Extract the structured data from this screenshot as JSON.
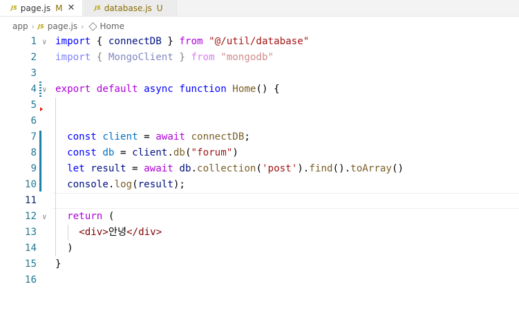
{
  "tabs": [
    {
      "badge": "JS",
      "name": "page.js",
      "status": "M",
      "close": "✕"
    },
    {
      "badge": "JS",
      "name": "database.js",
      "status": "U"
    }
  ],
  "breadcrumb": {
    "folder": "app",
    "file_badge": "JS",
    "file": "page.js",
    "symbol": "Home"
  },
  "colors": {
    "keyword": "#0000ff",
    "control": "#af00db",
    "variable": "#001080",
    "function": "#795e26",
    "string": "#a31515",
    "line_number": "#237893"
  },
  "code_lines": [
    {
      "number": "1",
      "tokens": [
        [
          "kw",
          "import"
        ],
        [
          "punc",
          " { "
        ],
        [
          "var",
          "connectDB"
        ],
        [
          "punc",
          " } "
        ],
        [
          "ctl",
          "from"
        ],
        [
          "punc",
          " "
        ],
        [
          "str",
          "\"@/util/database\""
        ]
      ]
    },
    {
      "number": "2",
      "dim": true,
      "tokens": [
        [
          "kw",
          "import"
        ],
        [
          "punc",
          " { "
        ],
        [
          "var",
          "MongoClient"
        ],
        [
          "punc",
          " } "
        ],
        [
          "ctl",
          "from"
        ],
        [
          "punc",
          " "
        ],
        [
          "str",
          "\"mongodb\""
        ]
      ]
    },
    {
      "number": "3",
      "tokens": []
    },
    {
      "number": "4",
      "tokens": [
        [
          "ctl",
          "export"
        ],
        [
          "punc",
          " "
        ],
        [
          "ctl",
          "default"
        ],
        [
          "punc",
          " "
        ],
        [
          "kw",
          "async"
        ],
        [
          "punc",
          " "
        ],
        [
          "kw",
          "function"
        ],
        [
          "punc",
          " "
        ],
        [
          "fn",
          "Home"
        ],
        [
          "punc",
          "() {"
        ]
      ]
    },
    {
      "number": "5",
      "tokens": []
    },
    {
      "number": "6",
      "tokens": []
    },
    {
      "number": "7",
      "tokens": [
        [
          "punc",
          "  "
        ],
        [
          "kw",
          "const"
        ],
        [
          "punc",
          " "
        ],
        [
          "const",
          "client"
        ],
        [
          "punc",
          " = "
        ],
        [
          "ctl",
          "await"
        ],
        [
          "punc",
          " "
        ],
        [
          "fn",
          "connectDB"
        ],
        [
          "punc",
          ";"
        ]
      ]
    },
    {
      "number": "8",
      "tokens": [
        [
          "punc",
          "  "
        ],
        [
          "kw",
          "const"
        ],
        [
          "punc",
          " "
        ],
        [
          "const",
          "db"
        ],
        [
          "punc",
          " = "
        ],
        [
          "var",
          "client"
        ],
        [
          "punc",
          "."
        ],
        [
          "fn",
          "db"
        ],
        [
          "punc",
          "("
        ],
        [
          "str",
          "\"forum\""
        ],
        [
          "punc",
          ")"
        ]
      ]
    },
    {
      "number": "9",
      "tokens": [
        [
          "punc",
          "  "
        ],
        [
          "kw",
          "let"
        ],
        [
          "punc",
          " "
        ],
        [
          "var",
          "result"
        ],
        [
          "punc",
          " = "
        ],
        [
          "ctl",
          "await"
        ],
        [
          "punc",
          " "
        ],
        [
          "var",
          "db"
        ],
        [
          "punc",
          "."
        ],
        [
          "fn",
          "collection"
        ],
        [
          "punc",
          "("
        ],
        [
          "str",
          "'post'"
        ],
        [
          "punc",
          ")."
        ],
        [
          "fn",
          "find"
        ],
        [
          "punc",
          "()."
        ],
        [
          "fn",
          "toArray"
        ],
        [
          "punc",
          "()"
        ]
      ]
    },
    {
      "number": "10",
      "tokens": [
        [
          "punc",
          "  "
        ],
        [
          "var",
          "console"
        ],
        [
          "punc",
          "."
        ],
        [
          "fn",
          "log"
        ],
        [
          "punc",
          "("
        ],
        [
          "var",
          "result"
        ],
        [
          "punc",
          ");"
        ]
      ]
    },
    {
      "number": "11",
      "tokens": []
    },
    {
      "number": "12",
      "tokens": [
        [
          "punc",
          "  "
        ],
        [
          "ctl",
          "return"
        ],
        [
          "punc",
          " ("
        ]
      ]
    },
    {
      "number": "13",
      "tokens": [
        [
          "punc",
          "    "
        ],
        [
          "tag",
          "<div>"
        ],
        [
          "txt",
          "안녕"
        ],
        [
          "tag",
          "</div>"
        ]
      ]
    },
    {
      "number": "14",
      "tokens": [
        [
          "punc",
          "  "
        ],
        [
          "punc",
          ")"
        ]
      ]
    },
    {
      "number": "15",
      "tokens": [
        [
          "punc",
          "}"
        ]
      ]
    },
    {
      "number": "16",
      "tokens": []
    }
  ],
  "fold_lines": [
    "1",
    "4",
    "12"
  ],
  "active_line": "11"
}
